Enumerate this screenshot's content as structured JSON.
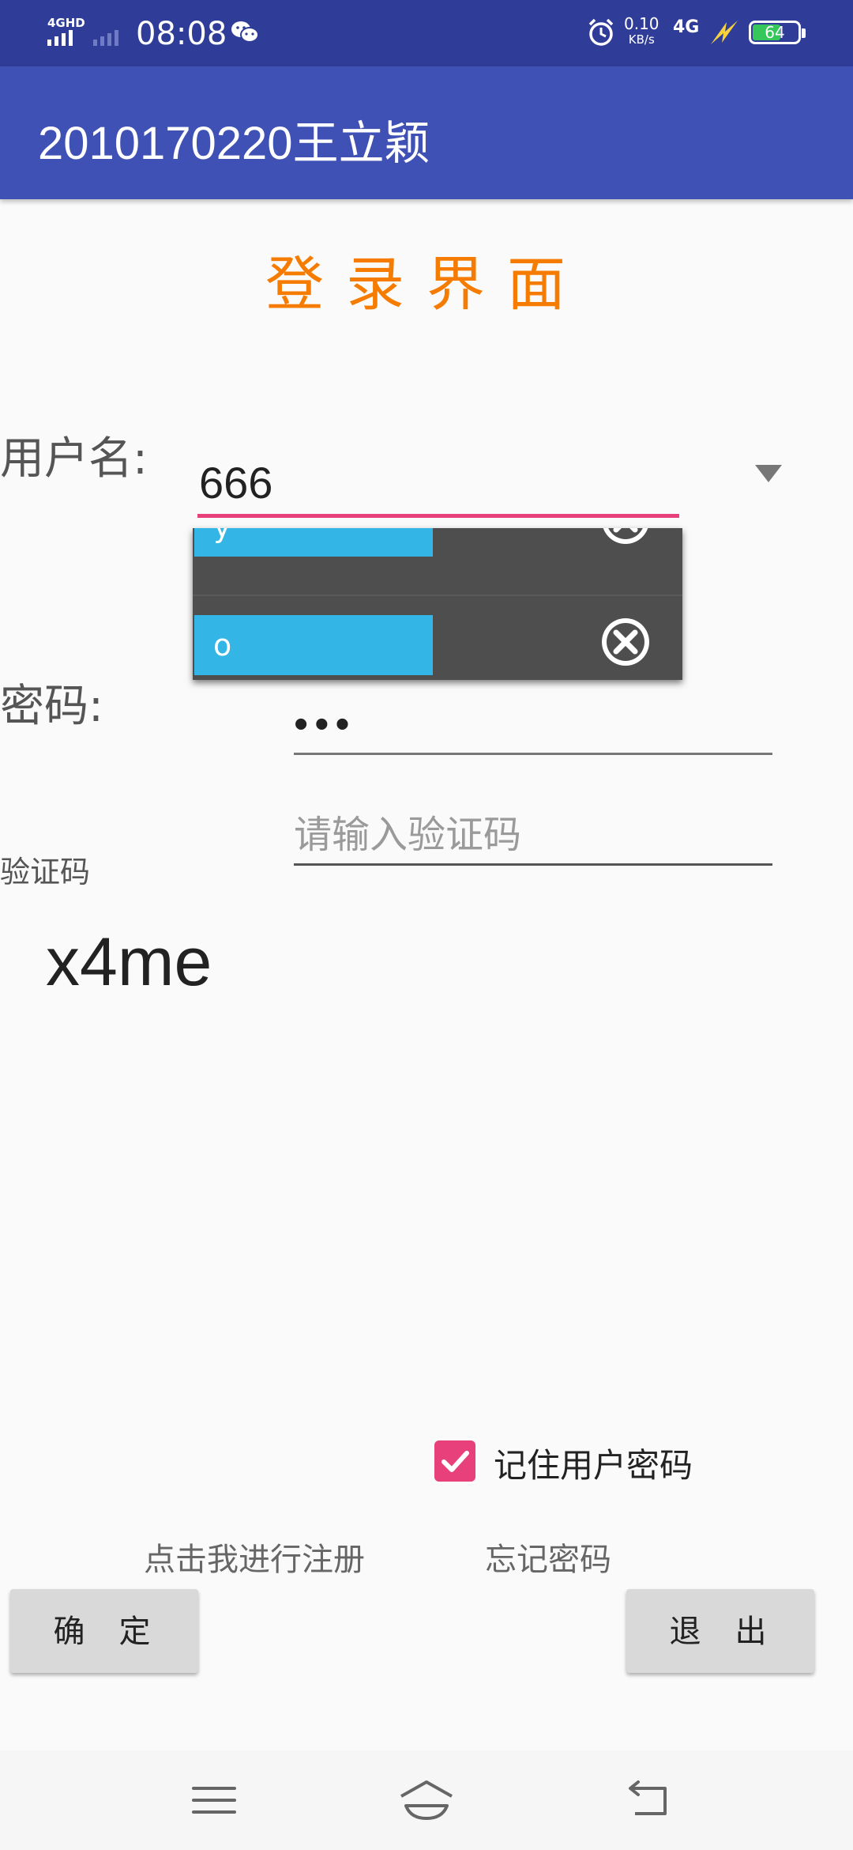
{
  "status_bar": {
    "network_label": "4GHD",
    "time": "08:08",
    "net_speed_value": "0.10",
    "net_speed_unit": "KB/s",
    "network_type": "4G",
    "battery_level": "64"
  },
  "app_bar": {
    "title": "2010170220王立颖"
  },
  "login": {
    "title": "登录界面",
    "username_label": "用户名:",
    "username_value": "666",
    "password_label": "密码:",
    "password_value": "•••",
    "captcha_label": "验证码",
    "captcha_placeholder": "请输入验证码",
    "captcha_code": "x4me"
  },
  "dropdown": {
    "items": [
      {
        "label": "y"
      },
      {
        "label": "o"
      }
    ]
  },
  "options": {
    "remember_label": "记住用户密码",
    "remember_checked": true,
    "register_link": "点击我进行注册",
    "forgot_link": "忘记密码"
  },
  "buttons": {
    "confirm": "确 定",
    "exit": "退 出"
  },
  "colors": {
    "status_bar": "#2f3d99",
    "app_bar": "#3f51b5",
    "title_accent": "#f57c00",
    "input_accent": "#e8407a",
    "dropdown_item": "#33b5e5"
  }
}
